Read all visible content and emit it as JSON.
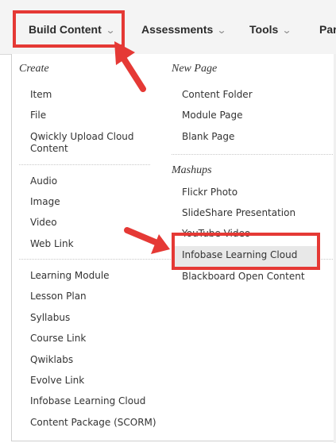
{
  "menubar": {
    "items": [
      {
        "label": "Build Content"
      },
      {
        "label": "Assessments"
      },
      {
        "label": "Tools"
      },
      {
        "label": "Par"
      }
    ]
  },
  "dropdown": {
    "left_column": {
      "create_heading": "Create",
      "create_items": [
        "Item",
        "File",
        "Qwickly Upload Cloud",
        "Content"
      ],
      "media_items": [
        "Audio",
        "Image",
        "Video",
        "Web Link"
      ],
      "module_items": [
        "Learning Module",
        "Lesson Plan",
        "Syllabus",
        "Course Link",
        "Qwiklabs",
        "Evolve Link",
        "Infobase Learning Cloud",
        "Content Package (SCORM)"
      ]
    },
    "right_column": {
      "new_page_heading": "New Page",
      "new_page_items": [
        "Content Folder",
        "Module Page",
        "Blank Page"
      ],
      "mashups_heading": "Mashups",
      "mashups_items": [
        "Flickr Photo",
        "SlideShare Presentation",
        "YouTube Video",
        "Infobase Learning Cloud",
        "Blackboard Open Content"
      ]
    }
  },
  "colors": {
    "highlight": "#e53935",
    "text": "#333333"
  }
}
